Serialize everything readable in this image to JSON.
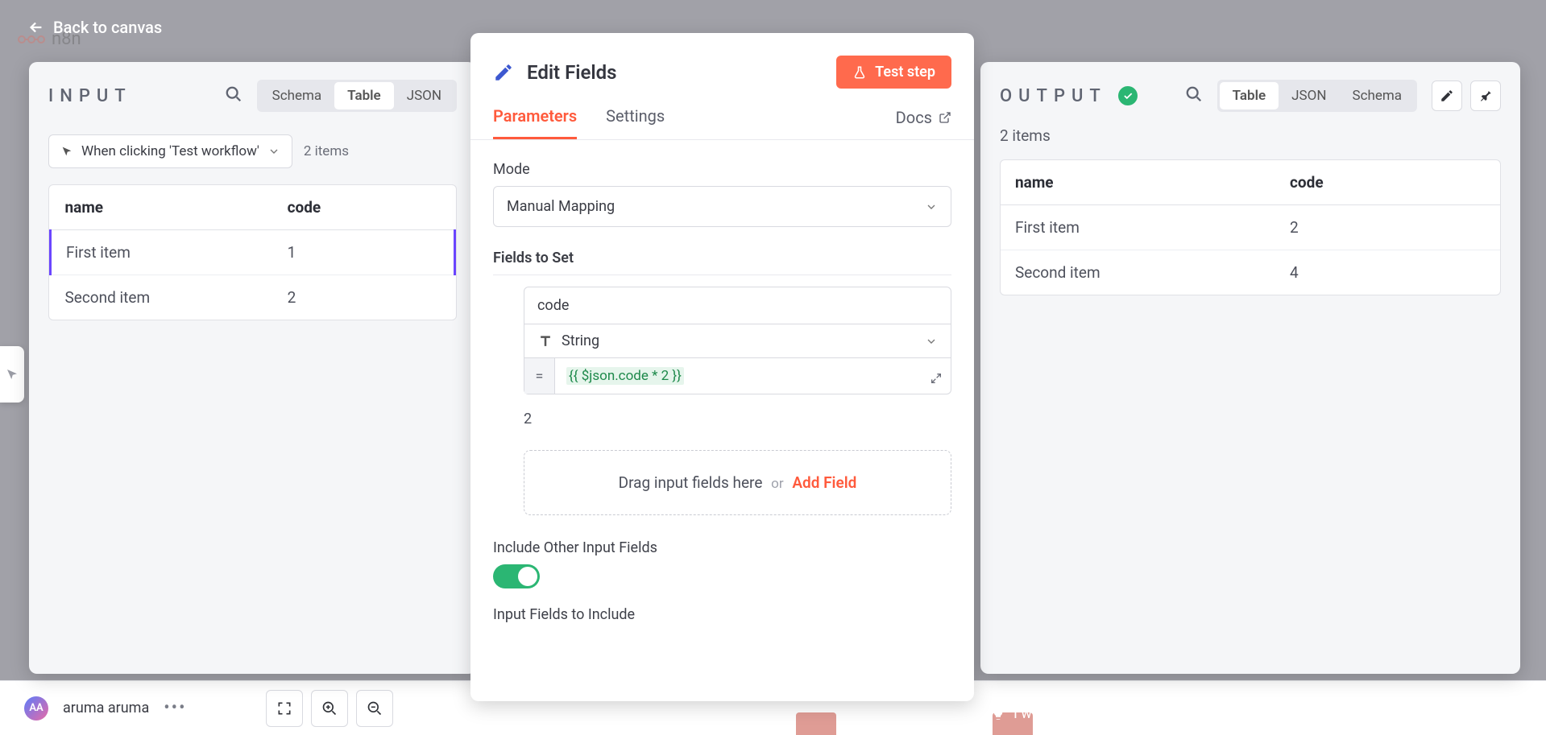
{
  "back_link": "Back to canvas",
  "app_name": "n8n",
  "input": {
    "title": "INPUT",
    "tabs": [
      "Schema",
      "Table",
      "JSON"
    ],
    "active_tab": "Table",
    "trigger": "When clicking 'Test workflow'",
    "items_count": "2 items",
    "columns": [
      "name",
      "code"
    ],
    "rows": [
      {
        "name": "First item",
        "code": "1"
      },
      {
        "name": "Second item",
        "code": "2"
      }
    ]
  },
  "center": {
    "title": "Edit Fields",
    "test_btn": "Test step",
    "tabs": {
      "parameters": "Parameters",
      "settings": "Settings"
    },
    "docs": "Docs",
    "mode_label": "Mode",
    "mode_value": "Manual Mapping",
    "fields_label": "Fields to Set",
    "field": {
      "name": "code",
      "type": "String",
      "expression": "{{ $json.code * 2 }}",
      "result": "2"
    },
    "drop": {
      "text": "Drag input fields here",
      "or": "or",
      "add": "Add Field"
    },
    "include_label": "Include Other Input Fields",
    "include_on": true,
    "input_fields_label": "Input Fields to Include"
  },
  "output": {
    "title": "OUTPUT",
    "tabs": [
      "Table",
      "JSON",
      "Schema"
    ],
    "active_tab": "Table",
    "items_count": "2 items",
    "columns": [
      "name",
      "code"
    ],
    "rows": [
      {
        "name": "First item",
        "code": "2"
      },
      {
        "name": "Second item",
        "code": "4"
      }
    ]
  },
  "footer": {
    "user_initials": "AA",
    "username": "aruma aruma",
    "wish": "I wish this node would…"
  }
}
